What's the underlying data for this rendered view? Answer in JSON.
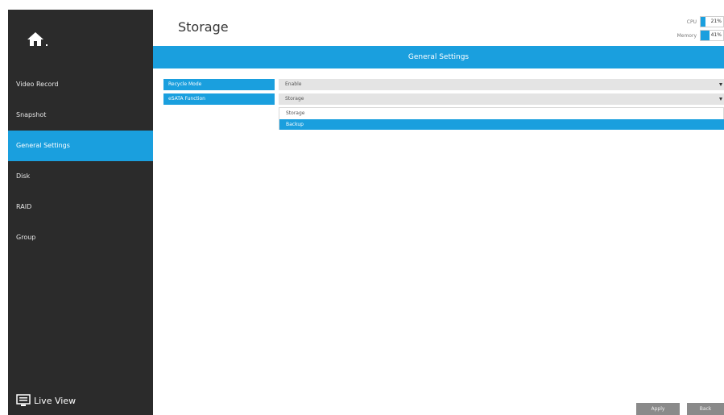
{
  "sidebar": {
    "home_icon": "home-icon",
    "items": [
      {
        "label": "Video Record",
        "active": false
      },
      {
        "label": "Snapshot",
        "active": false
      },
      {
        "label": "General Settings",
        "active": true
      },
      {
        "label": "Disk",
        "active": false
      },
      {
        "label": "RAID",
        "active": false
      },
      {
        "label": "Group",
        "active": false
      }
    ],
    "live_view_label": "Live View",
    "live_view_icon": "monitor-icon"
  },
  "header": {
    "title": "Storage",
    "cpu_label": "CPU",
    "cpu_value": "21%",
    "cpu_percent": 21,
    "memory_label": "Memory",
    "memory_value": "41%",
    "memory_percent": 41
  },
  "banner": {
    "title": "General Settings"
  },
  "form": {
    "recycle_mode_label": "Recycle Mode",
    "recycle_mode_value": "Enable",
    "esata_label": "eSATA Function",
    "esata_value": "Storage",
    "esata_options": [
      "Storage",
      "Backup"
    ],
    "esata_highlighted": "Backup"
  },
  "footer": {
    "apply_label": "Apply",
    "back_label": "Back"
  },
  "colors": {
    "accent": "#1a9fde",
    "sidebar_bg": "#2b2b2b",
    "button_bg": "#8a8a8a"
  }
}
